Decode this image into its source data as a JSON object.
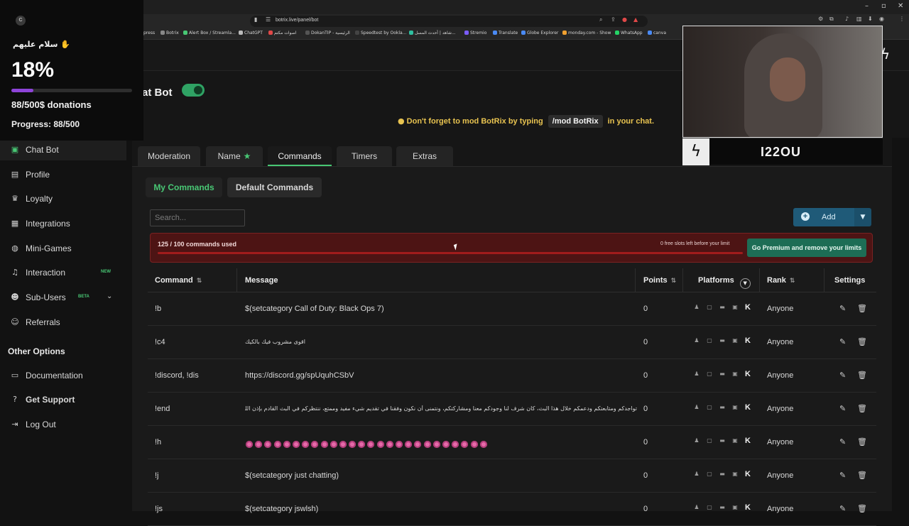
{
  "browser": {
    "url": "botrix.live/panel/bot",
    "bookmarks": [
      "press",
      "Botrix",
      "Alert Box / Streamla...",
      "ChatGPT",
      "اصوات مكتم",
      "DokanTIP - الرئيسية",
      "Speedtest by Ookla...",
      "شاهد | أحدث المسل...",
      "Stremio",
      "Translate",
      "Globe Explorer",
      "monday.com - Show",
      "WhatsApp",
      "canva"
    ]
  },
  "overlay": {
    "logo_letter": "C",
    "greeting": "سلام عليهم ✋",
    "percent": "18%",
    "progress_fraction": 0.18,
    "goal": "88/500$ donations",
    "progress": "Progress: 88/500"
  },
  "page": {
    "title": "at Bot",
    "notice_prefix": "Don't forget to mod BotRix by typing",
    "notice_code": "/mod BotRix",
    "notice_suffix": "in your chat.",
    "toggle_on": true
  },
  "sidebar": {
    "items": [
      {
        "label": "Chat Bot",
        "icon": "robot-icon"
      },
      {
        "label": "Profile",
        "icon": "id-card-icon"
      },
      {
        "label": "Loyalty",
        "icon": "trophy-icon"
      },
      {
        "label": "Integrations",
        "icon": "plug-icon"
      },
      {
        "label": "Mini-Games",
        "icon": "gamepad-icon"
      },
      {
        "label": "Interaction",
        "icon": "music-icon",
        "badge": "NEW"
      },
      {
        "label": "Sub-Users",
        "icon": "users-icon",
        "badge": "BETA"
      },
      {
        "label": "Referrals",
        "icon": "people-icon"
      }
    ],
    "section": "Other Options",
    "other": [
      {
        "label": "Documentation",
        "icon": "book-icon"
      },
      {
        "label": "Get Support",
        "icon": "question-icon"
      },
      {
        "label": "Log Out",
        "icon": "logout-icon"
      }
    ]
  },
  "tabs": [
    "Moderation",
    "Name",
    "Commands",
    "Timers",
    "Extras"
  ],
  "subtabs": [
    "My Commands",
    "Default Commands"
  ],
  "search": {
    "placeholder": "Search..."
  },
  "add": {
    "label": "Add"
  },
  "limit": {
    "used": "125 / 100 commands used",
    "free": "0 free slots left before your limit",
    "premium": "Go Premium and remove your limits"
  },
  "table": {
    "headers": [
      "Command",
      "Message",
      "Points",
      "Platforms",
      "Rank",
      "Settings"
    ],
    "rows": [
      {
        "command": "!b",
        "message": "$(setcategory Call of Duty: Black Ops 7)",
        "points": "0",
        "rank": "Anyone"
      },
      {
        "command": "!c4",
        "message": "اقوى مشروب فيك بالكيك",
        "points": "0",
        "rank": "Anyone",
        "rtl": true
      },
      {
        "command": "!discord, !dis",
        "message": "https://discord.gg/spUquhCSbV",
        "points": "0",
        "rank": "Anyone"
      },
      {
        "command": "!end",
        "message": "تواجدكم ومتابعتكم ودعمكم خلال هذا البث، كان شرف لنا وجودكم معنا ومشاركتكم، ونتمنى أن نكون وفقنا في تقديم شيء مفيد وممتع، ننتظركم في البث القادم بإذن الله",
        "points": "0",
        "rank": "Anyone",
        "rtl": true
      },
      {
        "command": "!h",
        "message": "",
        "points": "0",
        "rank": "Anyone",
        "emoji_count": 26
      },
      {
        "command": "!j",
        "message": "$(setcategory just chatting)",
        "points": "0",
        "rank": "Anyone"
      },
      {
        "command": "!js",
        "message": "$(setcategory jswlsh)",
        "points": "0",
        "rank": "Anyone"
      }
    ]
  },
  "cam": {
    "name": "I22OU"
  }
}
